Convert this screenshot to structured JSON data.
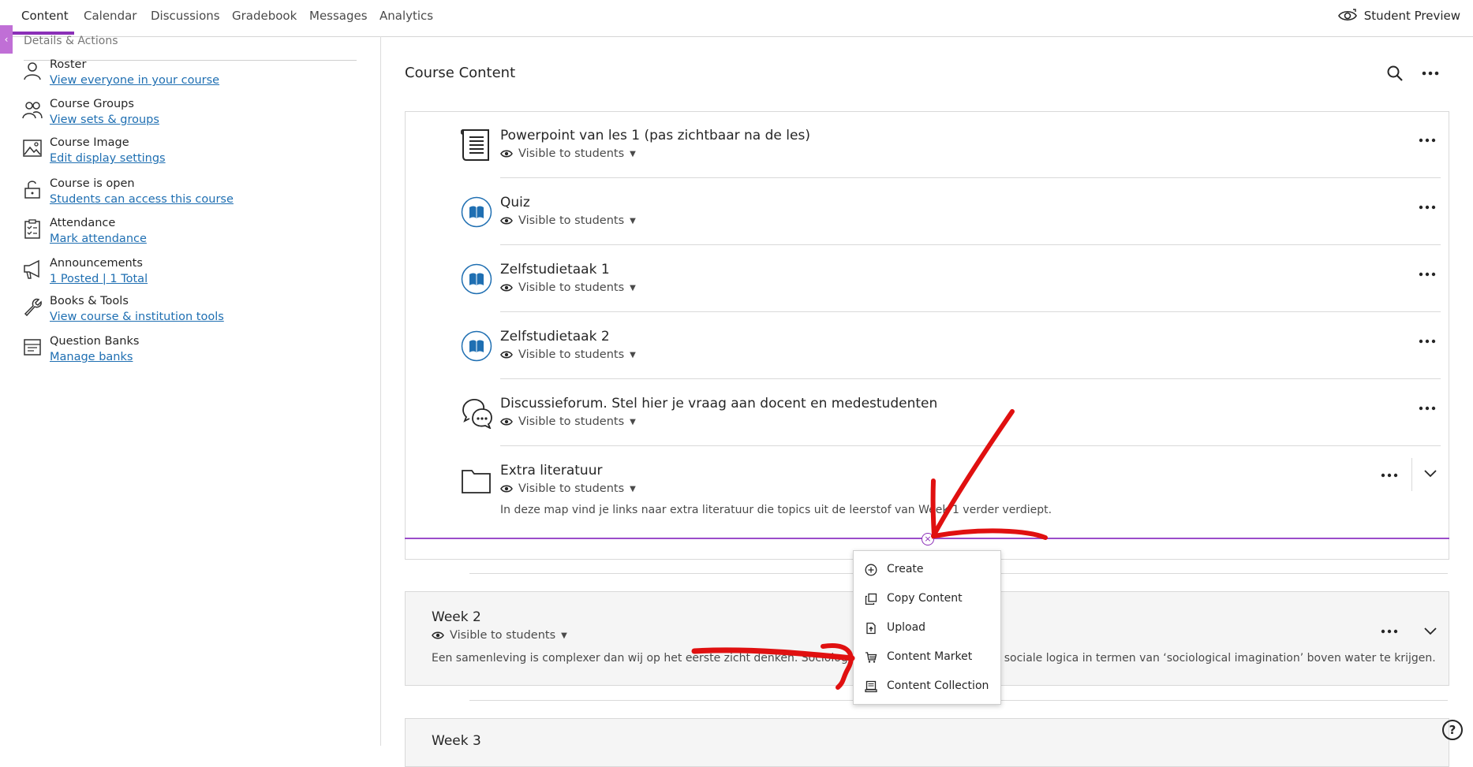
{
  "nav": {
    "tabs": [
      "Content",
      "Calendar",
      "Discussions",
      "Gradebook",
      "Messages",
      "Analytics"
    ],
    "student_preview": "Student Preview"
  },
  "sidebar": {
    "cut_heading": "Details & Actions",
    "items": [
      {
        "title": "Roster",
        "link": "View everyone in your course",
        "icon": "roster-icon"
      },
      {
        "title": "Course Groups",
        "link": "View sets & groups",
        "icon": "groups-icon"
      },
      {
        "title": "Course Image",
        "link": "Edit display settings",
        "icon": "image-icon"
      },
      {
        "title": "Course is open",
        "link": "Students can access this course",
        "icon": "unlock-icon"
      },
      {
        "title": "Attendance",
        "link": "Mark attendance",
        "icon": "attendance-icon"
      },
      {
        "title": "Announcements",
        "link": "1 Posted | 1 Total",
        "icon": "megaphone-icon"
      },
      {
        "title": "Books & Tools",
        "link": "View course & institution tools",
        "icon": "wrench-icon"
      },
      {
        "title": "Question Banks",
        "link": "Manage banks",
        "icon": "question-bank-icon"
      }
    ]
  },
  "main": {
    "title": "Course Content",
    "visibility": "Visible to students",
    "items": [
      {
        "title": "Powerpoint van les 1 (pas zichtbaar na de les)",
        "icon": "document-icon"
      },
      {
        "title": "Quiz",
        "icon": "assessment-book-icon"
      },
      {
        "title": "Zelfstudietaak 1",
        "icon": "assessment-book-icon"
      },
      {
        "title": "Zelfstudietaak 2",
        "icon": "assessment-book-icon"
      },
      {
        "title": "Discussieforum. Stel hier je vraag aan docent en medestudenten",
        "icon": "discussion-icon"
      },
      {
        "title": "Extra literatuur",
        "icon": "folder-icon",
        "description": "In deze map vind je links naar extra literatuur die topics uit de leerstof van Week 1 verder verdiept."
      }
    ],
    "weeks": [
      {
        "title": "Week 2",
        "description": "Een samenleving is complexer dan wij op het eerste zicht denken. Sociologie beoogt de onderliggende sociale logica in termen van ‘sociological imagination’ boven water te krijgen."
      },
      {
        "title": "Week 3"
      }
    ]
  },
  "add_menu": {
    "items": [
      "Create",
      "Copy Content",
      "Upload",
      "Content Market",
      "Content Collection"
    ],
    "highlighted": "Content Market"
  },
  "colors": {
    "accent": "#8b2fb8",
    "link": "#1f6fb2",
    "annotation": "#e01010",
    "highlight": "#f7f020"
  }
}
